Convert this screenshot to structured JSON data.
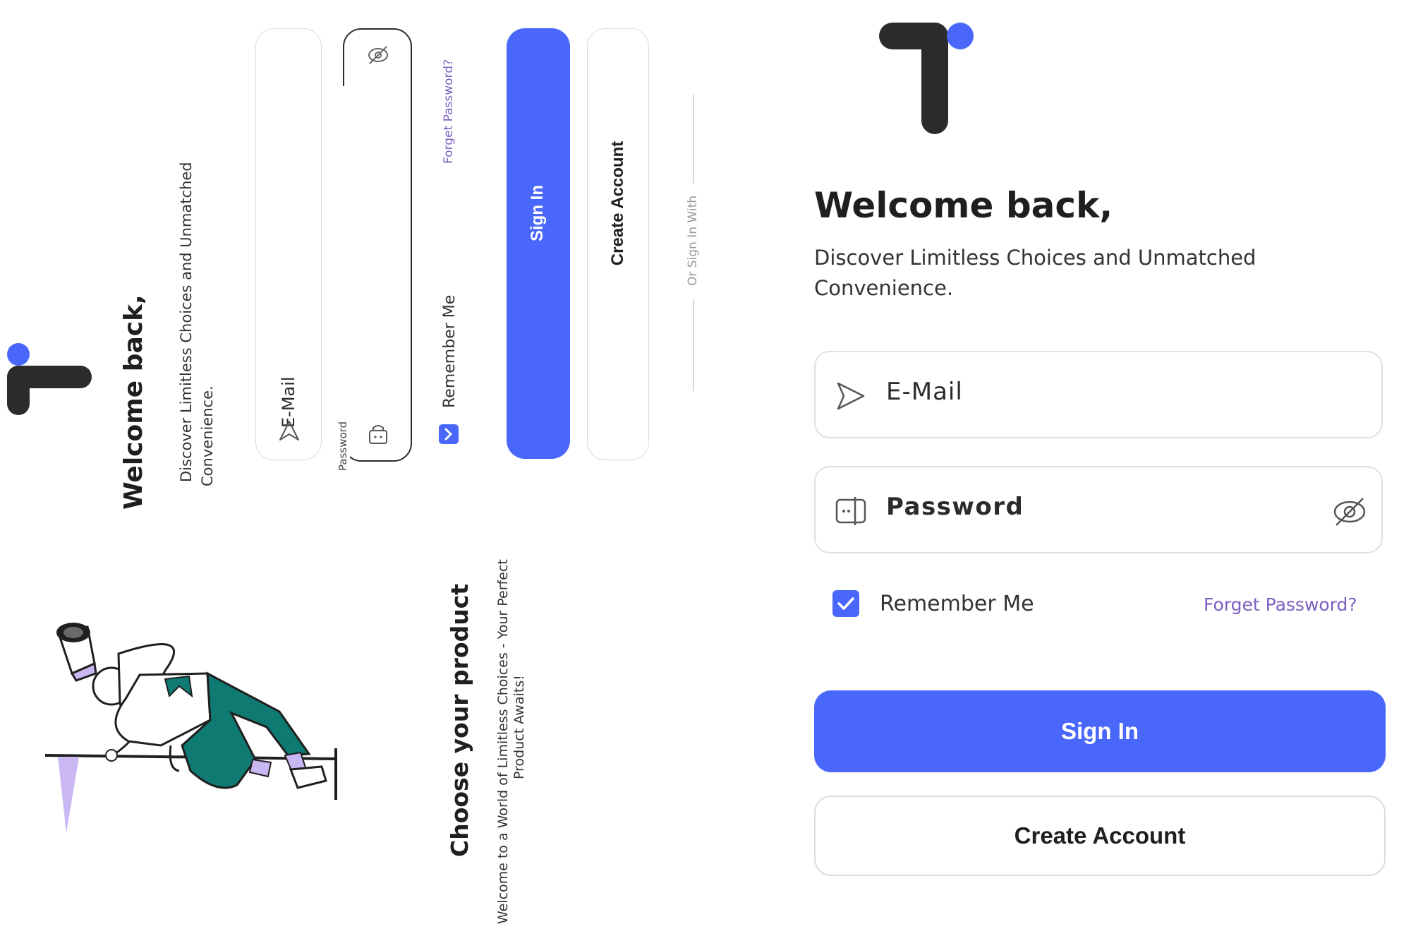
{
  "colors": {
    "accent": "#4a67fb",
    "dark": "#2b2b2b",
    "link": "#7b5fc0",
    "teal": "#0f7a72",
    "lavender": "#c9b8f3"
  },
  "rotated_screen": {
    "title": "Welcome back,",
    "subtitle_line1": "Discover Limitless Choices and Unmatched",
    "subtitle_line2": "Convenience.",
    "email_label": "E-Mail",
    "password_label": "Password",
    "remember_label": "Remember Me",
    "forgot_label": "Forget Password?",
    "signin_label": "Sign In",
    "create_label": "Create Account",
    "divider_label": "Or Sign In With",
    "onboarding_title": "Choose your product",
    "onboarding_line1": "Welcome to a World of Limitless Choices - Your Perfect",
    "onboarding_line2": "Product Awaits!"
  },
  "login": {
    "title": "Welcome back,",
    "subtitle_line1": "Discover Limitless Choices and Unmatched",
    "subtitle_line2": "Convenience.",
    "email_label": "E-Mail",
    "password_label": "Password",
    "remember_label": "Remember Me",
    "remember_checked": true,
    "forgot_label": "Forget Password?",
    "signin_label": "Sign In",
    "create_label": "Create Account"
  },
  "icons": {
    "logo": "logo-icon",
    "email": "send-icon",
    "password": "password-icon",
    "visibility": "eye-off-icon",
    "checkbox": "check-icon"
  }
}
